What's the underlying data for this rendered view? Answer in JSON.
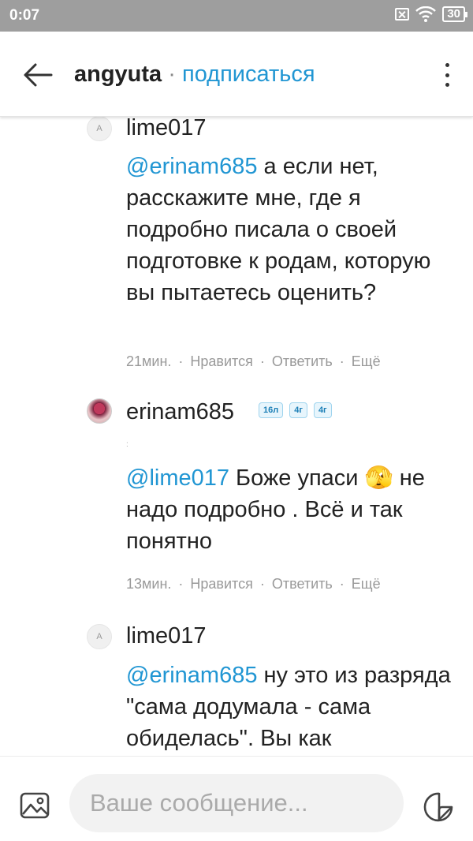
{
  "status_bar": {
    "time": "0:07",
    "battery": "30",
    "icons": [
      "sim-off-icon",
      "wifi-icon",
      "battery-icon"
    ]
  },
  "header": {
    "username": "angyuta",
    "separator": "·",
    "subscribe": "подписаться",
    "icons": [
      "back-arrow-icon",
      "more-vertical-icon"
    ]
  },
  "comments": [
    {
      "avatar": "A",
      "author": "lime017",
      "mention": "@erinam685",
      "text": " а если нет, расскажите мне, где я подробно писала о своей подготовке к родам, которую вы пытаетесь оценить?",
      "time": "21мин.",
      "like": "Нравится",
      "reply": "Ответить",
      "more": "Ещё"
    },
    {
      "avatar": "",
      "author": "erinam685",
      "badges": [
        "16л",
        "4г",
        "4г"
      ],
      "small_text": ":",
      "mention": "@lime017",
      "text": " Боже упаси 🫣 не надо подробно . Всё и так понятно",
      "time": "13мин.",
      "like": "Нравится",
      "reply": "Ответить",
      "more": "Ещё"
    },
    {
      "avatar": "A",
      "author": "lime017",
      "mention": "@erinam685",
      "text": " ну это из разряда \"сама додумала - сама обиделась\". Вы как"
    }
  ],
  "composer": {
    "placeholder": "Ваше сообщение...",
    "icons": [
      "image-icon",
      "sticker-icon"
    ]
  },
  "colors": {
    "accent": "#2196d3",
    "status_bar": "#9e9e9e",
    "meta_text": "#999999"
  }
}
